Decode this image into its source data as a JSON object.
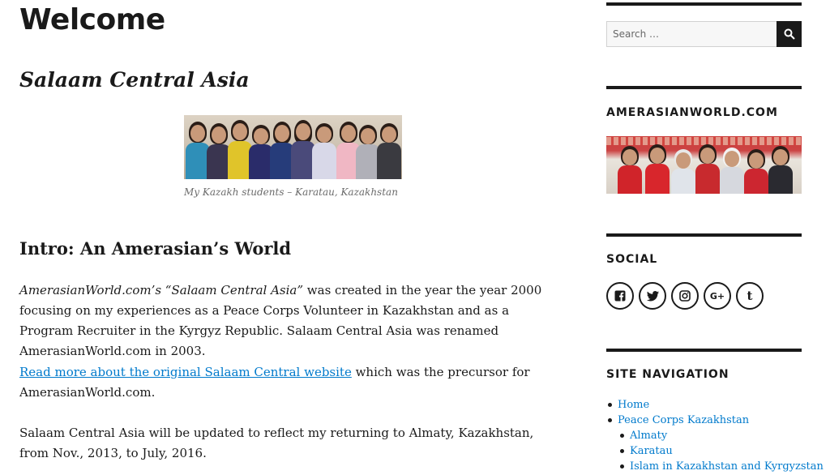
{
  "page": {
    "title": "Welcome",
    "subtitle": "Salaam Central Asia",
    "figure_caption": "My Kazakh students – Karatau, Kazakhstan",
    "intro_heading": "Intro: An Amerasian’s World",
    "p1_italic": "AmerasianWorld.com’s “Salaam Central Asia”",
    "p1_rest": " was created in the year the year 2000 focusing on my experiences as a Peace Corps Volunteer in Kazakhstan and as a Program Recruiter in the Kyrgyz Republic. Salaam Central Asia was renamed AmerasianWorld.com in 2003.",
    "p2_link": "Read more about the original Salaam Central website",
    "p2_rest": " which was the precursor for AmerasianWorld.com.",
    "p3": "Salaam Central Asia will be updated to reflect my returning to Almaty, Kazakhstan, from Nov., 2013, to July, 2016."
  },
  "sidebar": {
    "search_placeholder": "Search …",
    "search_icon": "search-icon",
    "widget_amerasian": "AMERASIANWORLD.COM",
    "widget_social": "SOCIAL",
    "social_icons": [
      "facebook-icon",
      "twitter-icon",
      "instagram-icon",
      "google-plus-icon",
      "tumblr-icon"
    ],
    "widget_nav": "SITE NAVIGATION",
    "nav_items": [
      {
        "label": "Home",
        "level": 0
      },
      {
        "label": "Peace Corps Kazakhstan",
        "level": 0
      },
      {
        "label": "Almaty",
        "level": 1
      },
      {
        "label": "Karatau",
        "level": 1
      },
      {
        "label": "Islam in Kazakhstan and Kyrgyzstan",
        "level": 1
      }
    ]
  },
  "colors": {
    "link": "#007acc",
    "text": "#1a1a1a",
    "caption": "#6b6b6b",
    "button": "#1a1a1a"
  }
}
